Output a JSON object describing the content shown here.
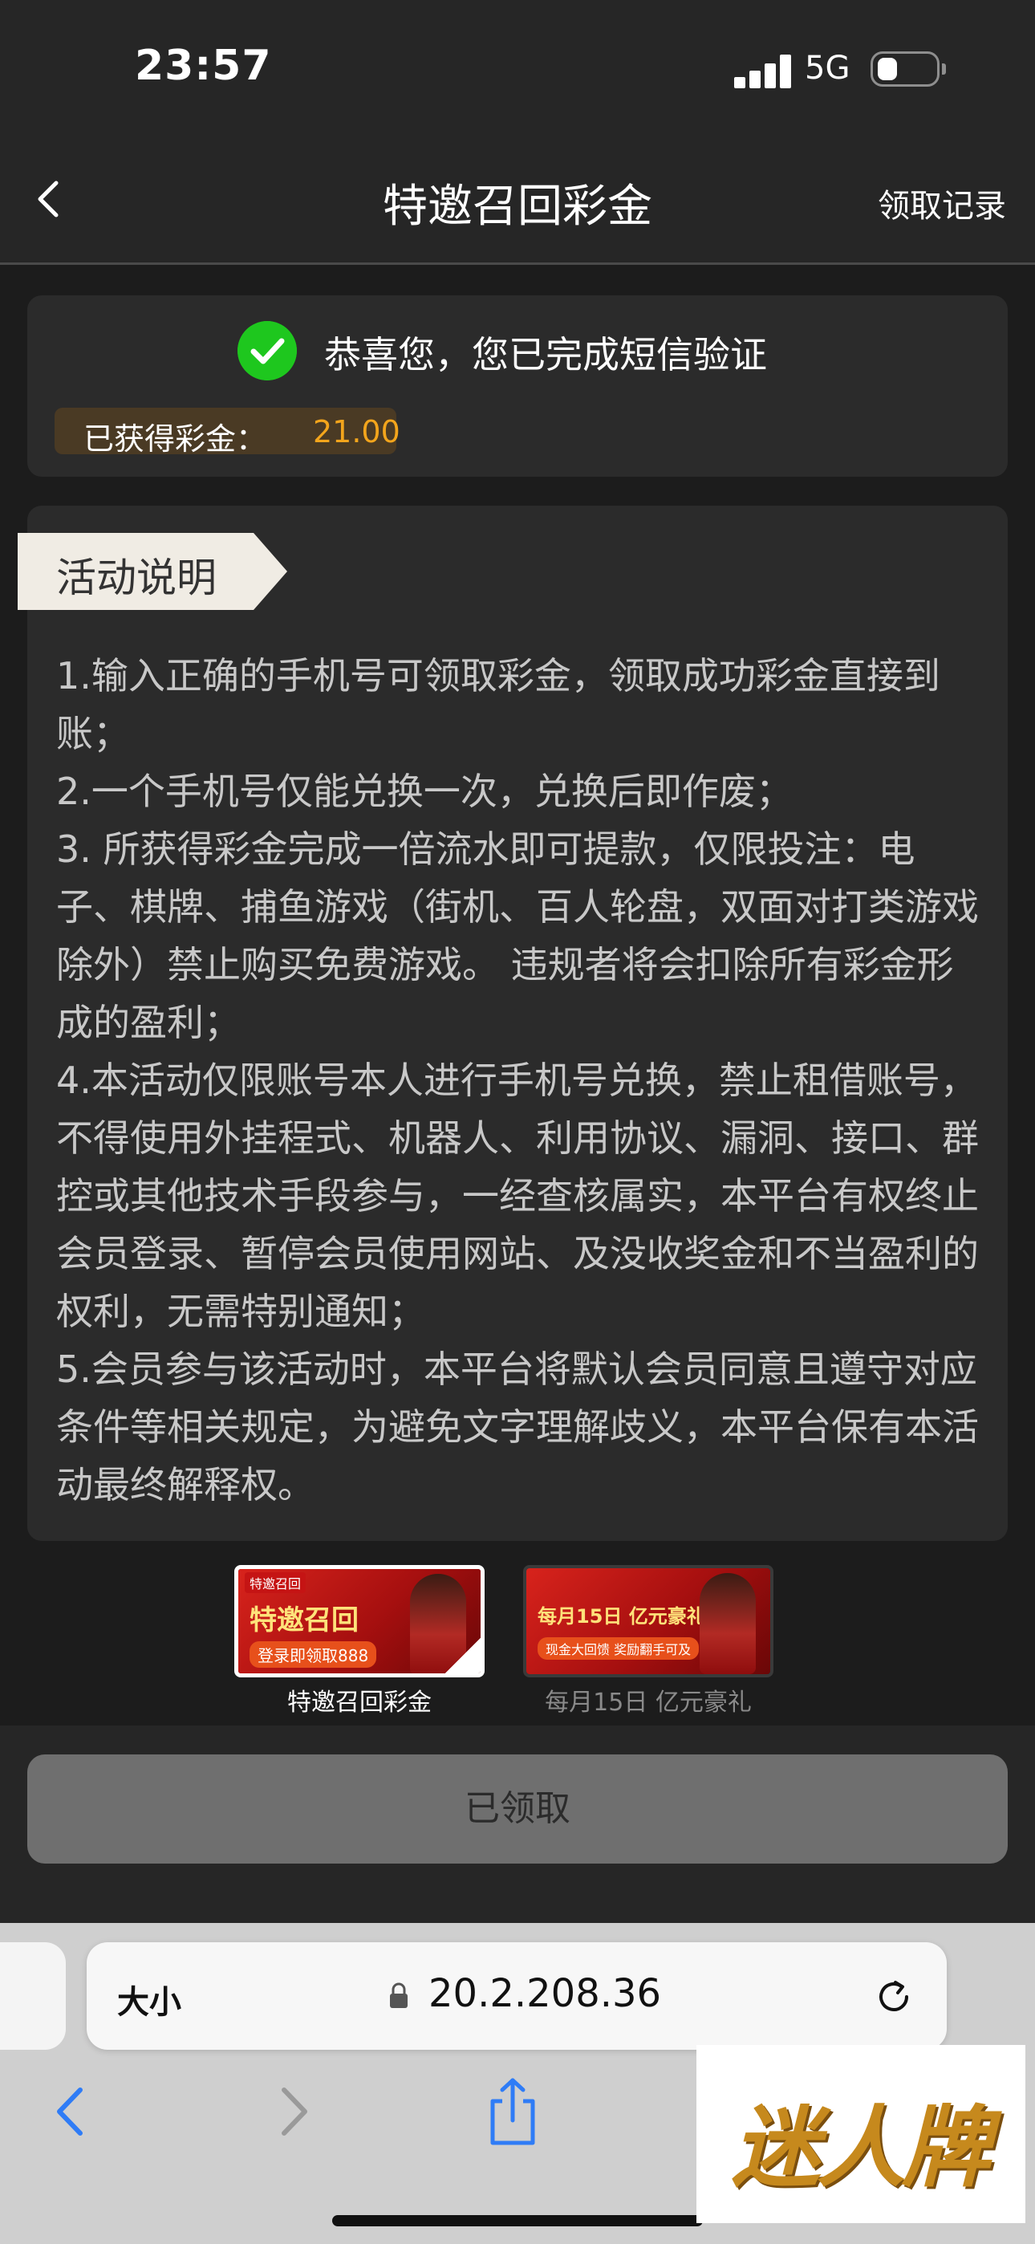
{
  "status_bar": {
    "time": "23:57",
    "network": "5G"
  },
  "nav": {
    "title": "特邀召回彩金",
    "record_link": "领取记录"
  },
  "verification": {
    "message": "恭喜您，您已完成短信验证",
    "bonus_label": "已获得彩金：",
    "bonus_value": "21.00"
  },
  "rules": {
    "tag": "活动说明",
    "items": [
      "1.输入正确的手机号可领取彩金，领取成功彩金直接到账；",
      "2.一个手机号仅能兑换一次，兑换后即作废；",
      "3. 所获得彩金完成一倍流水即可提款，仅限投注：电子、棋牌、捕鱼游戏（街机、百人轮盘，双面对打类游戏除外）禁止购买免费游戏。 违规者将会扣除所有彩金形成的盈利；",
      "4.本活动仅限账号本人进行手机号兑换，禁止租借账号，不得使用外挂程式、机器人、利用协议、漏洞、接口、群控或其他技术手段参与，一经查核属实，本平台有权终止会员登录、暂停会员使用网站、及没收奖金和不当盈利的权利，无需特别通知；",
      "5.会员参与该活动时，本平台将默认会员同意且遵守对应条件等相关规定，为避免文字理解歧义，本平台保有本活动最终解释权。"
    ]
  },
  "promos": [
    {
      "badge": "特邀召回",
      "title": "特邀召回",
      "subtitle": "登录即领取888",
      "caption": "特邀召回彩金",
      "selected": true
    },
    {
      "badge": "",
      "title": "每月15日 亿元豪礼",
      "subtitle": "现金大回馈 奖励翻手可及",
      "caption": "每月15日 亿元豪礼",
      "selected": false
    }
  ],
  "claim_button": {
    "label": "已领取"
  },
  "browser": {
    "text_size_label": "大小",
    "url": "20.2.208.36"
  },
  "watermark": "迷人牌",
  "colors": {
    "accent": "#f3a51c",
    "success": "#1ec71e",
    "background": "#1c1c1c",
    "card": "#2b2b2b"
  }
}
